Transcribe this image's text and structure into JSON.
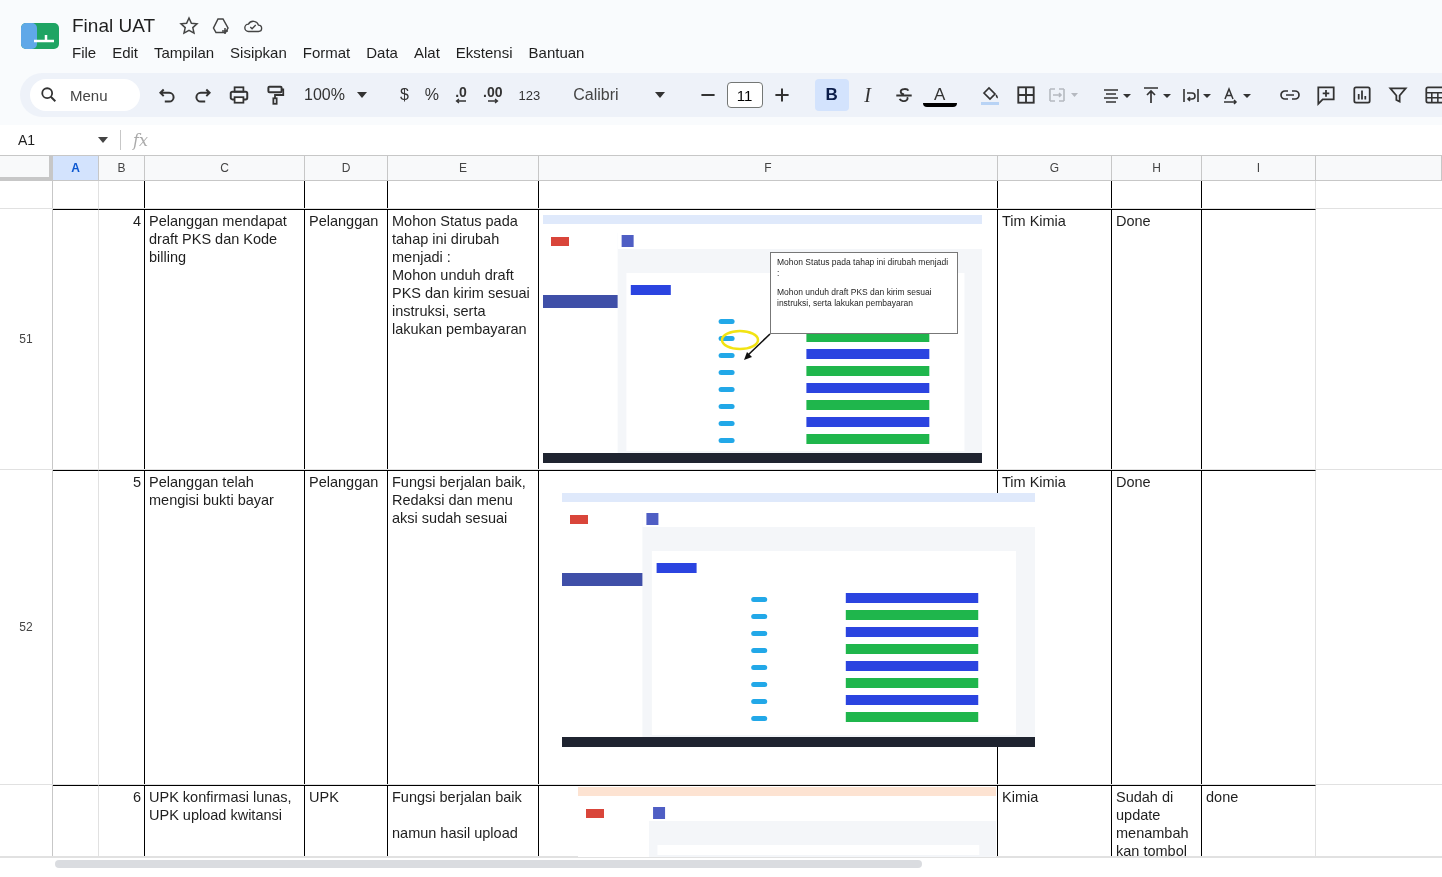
{
  "document": {
    "title": "Final UAT",
    "starred": false
  },
  "menu": [
    "File",
    "Edit",
    "Tampilan",
    "Sisipkan",
    "Format",
    "Data",
    "Alat",
    "Ekstensi",
    "Bantuan"
  ],
  "toolbar": {
    "search_placeholder": "Menu",
    "zoom": "100%",
    "currency": "$",
    "percent": "%",
    "decrease_decimals": ".0",
    "increase_decimals": ".00",
    "more_formats": "123",
    "font": "Calibri",
    "font_size": "11",
    "bold": {
      "label": "B",
      "selected": true
    },
    "italic": "I",
    "text_color": "A",
    "merge_disabled": true
  },
  "formula_bar": {
    "name_box": "A1",
    "fx": "fx"
  },
  "columns": [
    {
      "label": "A",
      "selected": true
    },
    {
      "label": "B",
      "selected": false
    },
    {
      "label": "C",
      "selected": false
    },
    {
      "label": "D",
      "selected": false
    },
    {
      "label": "E",
      "selected": false
    },
    {
      "label": "F",
      "selected": false
    },
    {
      "label": "G",
      "selected": false
    },
    {
      "label": "H",
      "selected": false
    },
    {
      "label": "I",
      "selected": false
    }
  ],
  "rows": [
    {
      "number": "",
      "cells": [
        "",
        "",
        "",
        "",
        "",
        "",
        "",
        "",
        ""
      ]
    },
    {
      "number": "51",
      "cells": [
        "",
        "4",
        "Pelanggan mendapat draft PKS dan Kode billing",
        "Pelanggan",
        "Mohon Status pada tahap ini dirubah menjadi :\nMohon unduh draft PKS dan kirim sesuai instruksi, serta lakukan pembayaran",
        "",
        "Tim Kimia",
        "Done",
        ""
      ]
    },
    {
      "number": "52",
      "cells": [
        "",
        "5",
        "Pelanggan telah mengisi bukti bayar",
        "Pelanggan",
        "Fungsi berjalan baik, Redaksi dan menu aksi sudah sesuai",
        "",
        "Tim Kimia",
        "Done",
        ""
      ]
    },
    {
      "number": "",
      "cells": [
        "",
        "6",
        "UPK konfirmasi lunas, UPK upload kwitansi",
        "UPK",
        "Fungsi berjalan baik\n\nnamun hasil upload",
        "",
        "Kimia",
        "Sudah di update menambah kan tombol",
        "done"
      ]
    }
  ],
  "images": [
    {
      "kind": "picture",
      "callout": [
        "Mohon Status pada tahap ini dirubah menjadi :",
        "Mohon unduh draft PKS dan kirim sesuai instruksi, serta lakukan pembayaran"
      ]
    },
    {
      "kind": "picture"
    },
    {
      "kind": "picture"
    }
  ]
}
